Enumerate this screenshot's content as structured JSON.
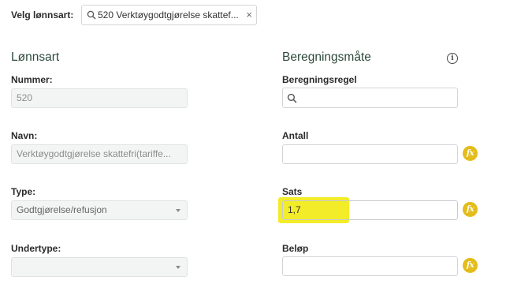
{
  "header": {
    "select_label": "Velg lønnsart:",
    "select_value": "520 Verktøygodtgjørelse skattef...",
    "clear_symbol": "×"
  },
  "left": {
    "section_title": "Lønnsart",
    "nummer_label": "Nummer:",
    "nummer_value": "520",
    "navn_label": "Navn:",
    "navn_value": "Verktøygodtgjørelse skattefri(tariffe...",
    "type_label": "Type:",
    "type_value": "Godtgjørelse/refusjon",
    "undertype_label": "Undertype:",
    "undertype_value": ""
  },
  "right": {
    "section_title": "Beregningsmåte",
    "info_symbol": "i",
    "beregningsregel_label": "Beregningsregel",
    "beregningsregel_value": "",
    "antall_label": "Antall",
    "antall_value": "",
    "sats_label": "Sats",
    "sats_value": "1,7",
    "belop_label": "Beløp",
    "belop_value": "",
    "fx_symbol": "fx"
  },
  "colors": {
    "accent_fx": "#e3bd1a",
    "highlight": "#f3ec28",
    "section_title": "#2e4a3c"
  }
}
